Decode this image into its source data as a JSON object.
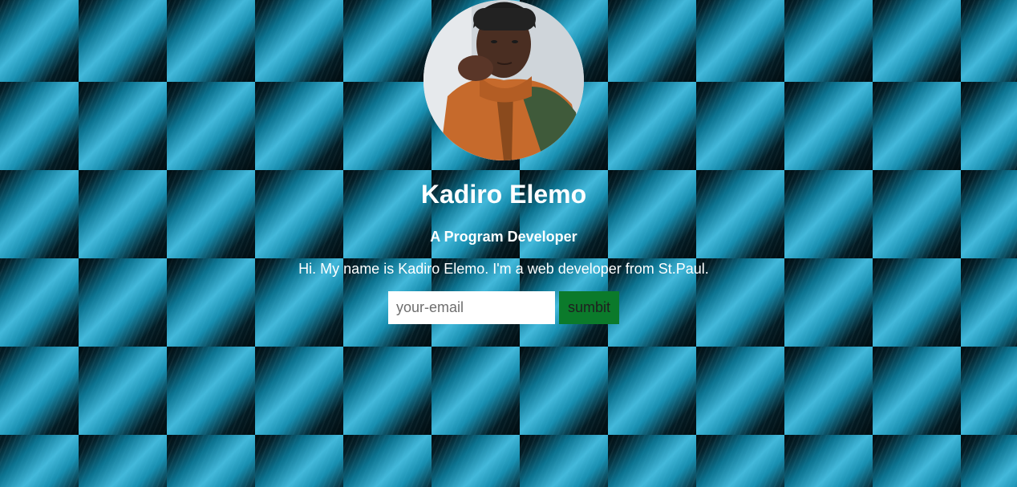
{
  "profile": {
    "name": "Kadiro Elemo",
    "title": "A Program Developer",
    "bio": "Hi. My name is Kadiro Elemo. I'm a web developer from St.Paul."
  },
  "signup": {
    "email_placeholder": "your-email",
    "email_value": "",
    "submit_label": "sumbit"
  },
  "colors": {
    "background": "#0a4f66",
    "submit_button": "#0b7a2b",
    "text": "#ffffff"
  }
}
